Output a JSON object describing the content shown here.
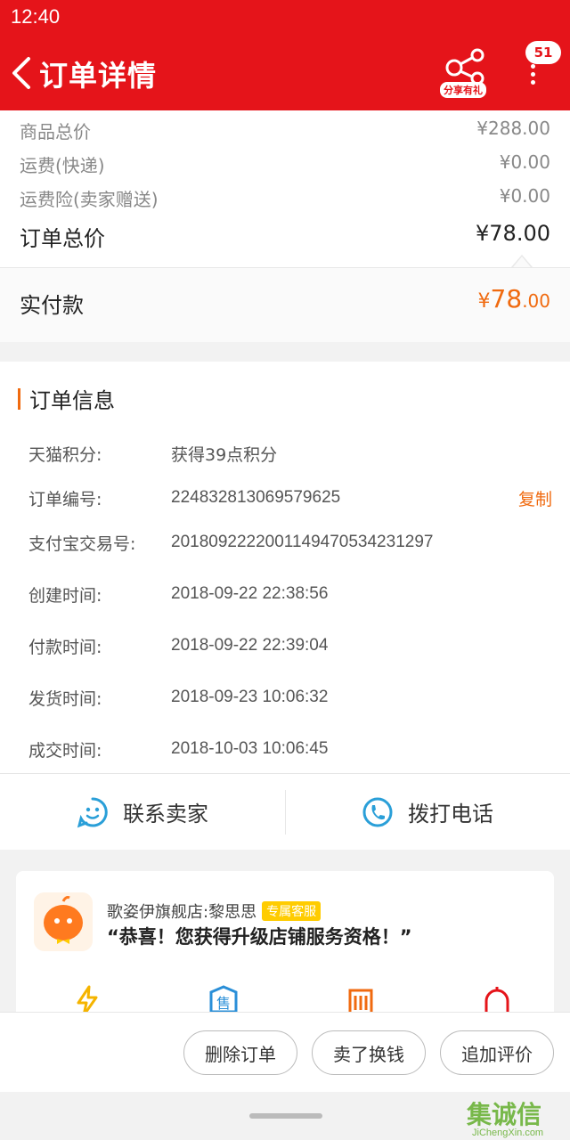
{
  "status": {
    "time": "12:40"
  },
  "header": {
    "title": "订单详情",
    "share_tag": "分享有礼",
    "badge_count": "51"
  },
  "price": {
    "rows": [
      {
        "label": "商品总价",
        "value": "¥288.00"
      },
      {
        "label": "运费(快递)",
        "value": "¥0.00"
      },
      {
        "label": "运费险(卖家赠送)",
        "value": "¥0.00"
      }
    ],
    "total_label": "订单总价",
    "total_value": "¥78.00",
    "paid_label": "实付款",
    "paid_currency": "¥",
    "paid_int": "78",
    "paid_dec": ".00"
  },
  "order_info": {
    "heading": "订单信息",
    "copy_label": "复制",
    "rows": [
      {
        "key": "天猫积分:",
        "value": "获得39点积分"
      },
      {
        "key": "订单编号:",
        "value": "224832813069579625"
      },
      {
        "key": "支付宝交易号:",
        "value": "2018092222001149470534231297"
      },
      {
        "key": "创建时间:",
        "value": "2018-09-22 22:38:56"
      },
      {
        "key": "付款时间:",
        "value": "2018-09-22 22:39:04"
      },
      {
        "key": "发货时间:",
        "value": "2018-09-23 10:06:32"
      },
      {
        "key": "成交时间:",
        "value": "2018-10-03 10:06:45"
      }
    ]
  },
  "contact": {
    "seller_label": "联系卖家",
    "phone_label": "拨打电话"
  },
  "store": {
    "name": "歌姿伊旗舰店:黎思思",
    "tag": "专属客服",
    "message": "“恭喜！您获得升级店铺服务资格！”",
    "icons": [
      "lightning-icon",
      "after-sale-icon",
      "shop-icon",
      "bell-icon"
    ],
    "icon_glyph": "售"
  },
  "actions": {
    "delete": "删除订单",
    "sell": "卖了换钱",
    "review": "追加评价"
  },
  "watermark": {
    "main": "集诚信",
    "sub": "JiChengXin.com"
  },
  "colors": {
    "brand_red": "#e5141a",
    "accent_orange": "#f06a0f"
  }
}
